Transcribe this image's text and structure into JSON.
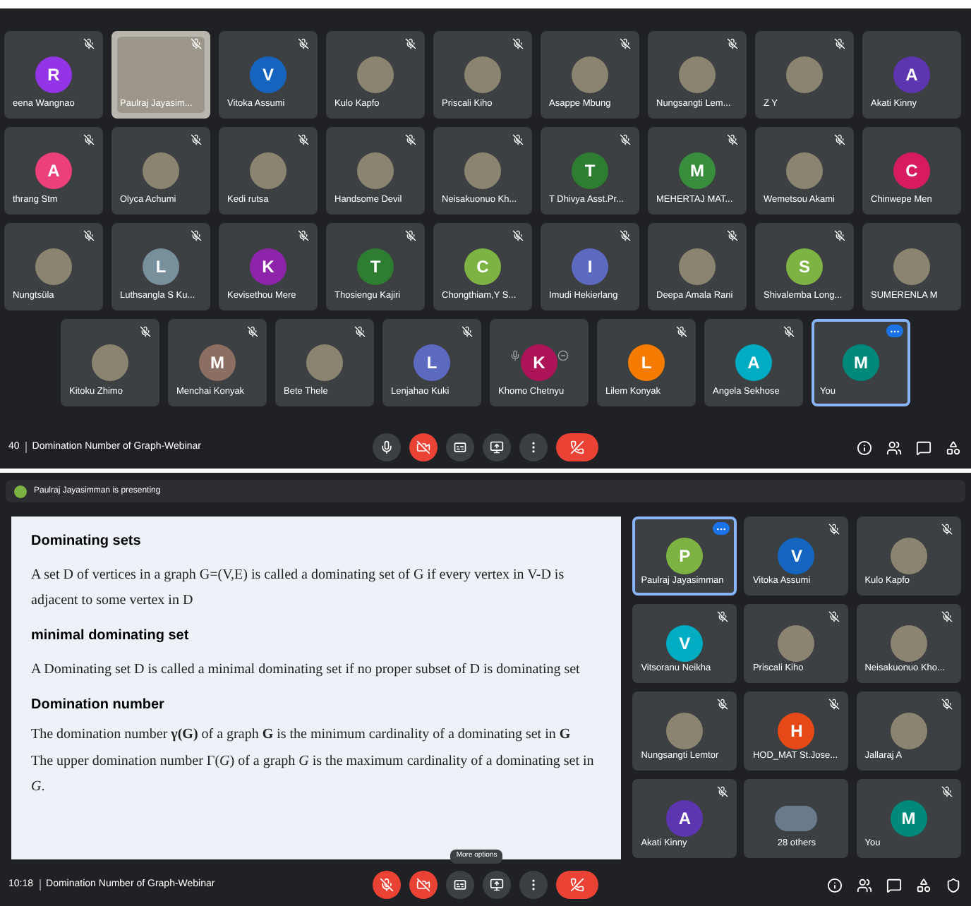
{
  "grid_meeting": {
    "rows": [
      {
        "tiles": [
          {
            "name": "eena Wangnao",
            "avatar": {
              "kind": "letter",
              "letter": "R",
              "color": "#9334e6"
            },
            "selected": false,
            "muted": true
          },
          {
            "name": "Paulraj Jayasim...",
            "avatar": {
              "kind": "video"
            },
            "selected": false,
            "muted": true
          },
          {
            "name": "Vitoka Assumi",
            "avatar": {
              "kind": "letter",
              "letter": "V",
              "color": "#1565c0"
            },
            "selected": false,
            "muted": true
          },
          {
            "name": "Kulo Kapfo",
            "avatar": {
              "kind": "photo"
            },
            "selected": false,
            "muted": true
          },
          {
            "name": "Priscali Kiho",
            "avatar": {
              "kind": "photo"
            },
            "selected": false,
            "muted": true
          },
          {
            "name": "Asappe Mbung",
            "avatar": {
              "kind": "photo"
            },
            "selected": false,
            "muted": true
          },
          {
            "name": "Nungsangti Lem...",
            "avatar": {
              "kind": "photo"
            },
            "selected": false,
            "muted": true
          },
          {
            "name": "Z Y",
            "avatar": {
              "kind": "photo"
            },
            "selected": false,
            "muted": true
          },
          {
            "name": "Akati Kinny",
            "avatar": {
              "kind": "letter",
              "letter": "A",
              "color": "#5e35b1"
            },
            "selected": false,
            "muted": false
          }
        ]
      },
      {
        "tiles": [
          {
            "name": "thrang Stm",
            "avatar": {
              "kind": "letter",
              "letter": "A",
              "color": "#ec407a"
            },
            "selected": false,
            "muted": true
          },
          {
            "name": "Olyca Achumi",
            "avatar": {
              "kind": "photo"
            },
            "selected": false,
            "muted": true
          },
          {
            "name": "Kedi rutsa",
            "avatar": {
              "kind": "photo"
            },
            "selected": false,
            "muted": true
          },
          {
            "name": "Handsome Devil",
            "avatar": {
              "kind": "photo"
            },
            "selected": false,
            "muted": true
          },
          {
            "name": "Neisakuonuo Kh...",
            "avatar": {
              "kind": "photo"
            },
            "selected": false,
            "muted": true
          },
          {
            "name": "T Dhivya Asst.Pr...",
            "avatar": {
              "kind": "letter",
              "letter": "T",
              "color": "#2e7d32"
            },
            "selected": false,
            "muted": true
          },
          {
            "name": "MEHERTAJ MAT...",
            "avatar": {
              "kind": "letter",
              "letter": "M",
              "color": "#388e3c"
            },
            "selected": false,
            "muted": true
          },
          {
            "name": "Wemetsou Akami",
            "avatar": {
              "kind": "photo"
            },
            "selected": false,
            "muted": true
          },
          {
            "name": "Chinwepe Men",
            "avatar": {
              "kind": "letter",
              "letter": "C",
              "color": "#d81b60"
            },
            "selected": false,
            "muted": false
          }
        ]
      },
      {
        "tiles": [
          {
            "name": "Nungtsüla",
            "avatar": {
              "kind": "photo"
            },
            "selected": false,
            "muted": true
          },
          {
            "name": "Luthsangla S Ku...",
            "avatar": {
              "kind": "letter",
              "letter": "L",
              "color": "#78909c"
            },
            "selected": false,
            "muted": true
          },
          {
            "name": "Kevisethou Mere",
            "avatar": {
              "kind": "letter",
              "letter": "K",
              "color": "#8e24aa"
            },
            "selected": false,
            "muted": true
          },
          {
            "name": "Thosiengu Kajiri",
            "avatar": {
              "kind": "letter",
              "letter": "T",
              "color": "#2e7d32"
            },
            "selected": false,
            "muted": true
          },
          {
            "name": "Chongthiam,Y S...",
            "avatar": {
              "kind": "letter",
              "letter": "C",
              "color": "#7cb342"
            },
            "selected": false,
            "muted": true
          },
          {
            "name": "Imudi Hekierlang",
            "avatar": {
              "kind": "letter",
              "letter": "I",
              "color": "#5c6bc0"
            },
            "selected": false,
            "muted": true
          },
          {
            "name": "Deepa Amala Rani",
            "avatar": {
              "kind": "photo"
            },
            "selected": false,
            "muted": true
          },
          {
            "name": "Shivalemba Long...",
            "avatar": {
              "kind": "letter",
              "letter": "S",
              "color": "#7cb342"
            },
            "selected": false,
            "muted": true
          },
          {
            "name": "SUMERENLA M",
            "avatar": {
              "kind": "photo"
            },
            "selected": false,
            "muted": false
          }
        ]
      },
      {
        "tiles": [
          {
            "name": "Kitoku Zhimo",
            "avatar": {
              "kind": "photo"
            },
            "selected": false,
            "muted": true
          },
          {
            "name": "Menchai Konyak",
            "avatar": {
              "kind": "letter",
              "letter": "M",
              "color": "#8d6e63"
            },
            "selected": false,
            "muted": true
          },
          {
            "name": "Bete Thele",
            "avatar": {
              "kind": "photo"
            },
            "selected": false,
            "muted": true
          },
          {
            "name": "Lenjahao Kuki",
            "avatar": {
              "kind": "letter",
              "letter": "L",
              "color": "#5c6bc0"
            },
            "selected": false,
            "muted": true
          },
          {
            "name": "Khomo Chetnyu",
            "avatar": {
              "kind": "letter",
              "letter": "K",
              "color": "#ad1457"
            },
            "selected": false,
            "muted": false,
            "hovered": true
          },
          {
            "name": "Lilem Konyak",
            "avatar": {
              "kind": "letter",
              "letter": "L",
              "color": "#f57c00"
            },
            "selected": false,
            "muted": true
          },
          {
            "name": "Angela Sekhose",
            "avatar": {
              "kind": "letter",
              "letter": "A",
              "color": "#00acc1"
            },
            "selected": false,
            "muted": true
          },
          {
            "name": "You",
            "avatar": {
              "kind": "letter",
              "letter": "M",
              "color": "#00897b"
            },
            "selected": true,
            "muted": false
          }
        ]
      }
    ],
    "bottom_bar": {
      "time": "40",
      "title": "Domination Number of Graph-Webinar",
      "controls": [
        {
          "kind": "mic",
          "on": true
        },
        {
          "kind": "camera",
          "on": false
        },
        {
          "kind": "captions"
        },
        {
          "kind": "present"
        },
        {
          "kind": "more"
        },
        {
          "kind": "end"
        }
      ],
      "side": [
        {
          "kind": "info"
        },
        {
          "kind": "people"
        },
        {
          "kind": "chat"
        },
        {
          "kind": "activities"
        }
      ]
    }
  },
  "presentation_meeting": {
    "presenting_banner": "Paulraj Jayasimman is presenting",
    "slide": [
      {
        "kind": "heading",
        "text": "Dominating sets"
      },
      {
        "kind": "paragraph",
        "text": "A set D of vertices in a graph G=(V,E) is called a dominating set of G if every vertex in V-D is adjacent to some vertex in D"
      },
      {
        "kind": "heading",
        "text": "minimal dominating set"
      },
      {
        "kind": "paragraph",
        "text": "A Dominating set D is called a minimal dominating set if no proper subset of D is dominating set"
      },
      {
        "kind": "heading",
        "text": "Domination number"
      },
      {
        "kind": "formula",
        "text": "The domination number **γ(G)** of a graph **G** is the minimum cardinality of a dominating set in **G**"
      },
      {
        "kind": "paragraph",
        "text": "The upper domination number Γ(*G*) of a graph *G* is the maximum cardinality of a dominating set in *G*."
      }
    ],
    "tiles": [
      {
        "name": "Paulraj Jayasimman",
        "avatar": {
          "kind": "letter",
          "letter": "P",
          "color": "#7cb342"
        },
        "selected": true,
        "muted": false
      },
      {
        "name": "Vitoka Assumi",
        "avatar": {
          "kind": "letter",
          "letter": "V",
          "color": "#1565c0"
        },
        "selected": false,
        "muted": true
      },
      {
        "name": "Kulo Kapfo",
        "avatar": {
          "kind": "photo"
        },
        "selected": false,
        "muted": true
      },
      {
        "name": "Vitsoranu Neikha",
        "avatar": {
          "kind": "letter",
          "letter": "V",
          "color": "#00acc1"
        },
        "selected": false,
        "muted": true
      },
      {
        "name": "Priscali Kiho",
        "avatar": {
          "kind": "photo"
        },
        "selected": false,
        "muted": true
      },
      {
        "name": "Neisakuonuo Kho...",
        "avatar": {
          "kind": "photo"
        },
        "selected": false,
        "muted": true
      },
      {
        "name": "Nungsangti Lemtor",
        "avatar": {
          "kind": "photo"
        },
        "selected": false,
        "muted": true
      },
      {
        "name": "HOD_MAT St.Jose...",
        "avatar": {
          "kind": "letter",
          "letter": "H",
          "color": "#e64a19"
        },
        "selected": false,
        "muted": true
      },
      {
        "name": "Jallaraj A",
        "avatar": {
          "kind": "photo"
        },
        "selected": false,
        "muted": true
      },
      {
        "name": "Akati Kinny",
        "avatar": {
          "kind": "letter",
          "letter": "A",
          "color": "#5e35b1"
        },
        "selected": false,
        "muted": true
      },
      {
        "name": "28 others",
        "avatar": {
          "kind": "group"
        },
        "selected": false,
        "muted": false
      },
      {
        "name": "You",
        "avatar": {
          "kind": "letter",
          "letter": "M",
          "color": "#00897b"
        },
        "selected": false,
        "muted": true
      }
    ],
    "bottom_bar": {
      "time": "10:18",
      "title": "Domination Number of Graph-Webinar",
      "tooltip": "More options",
      "controls": [
        {
          "kind": "mic",
          "on": false
        },
        {
          "kind": "camera",
          "on": false
        },
        {
          "kind": "captions"
        },
        {
          "kind": "present"
        },
        {
          "kind": "more"
        },
        {
          "kind": "end"
        }
      ],
      "side": [
        {
          "kind": "info"
        },
        {
          "kind": "people"
        },
        {
          "kind": "chat"
        },
        {
          "kind": "activities"
        },
        {
          "kind": "shield"
        }
      ]
    }
  }
}
